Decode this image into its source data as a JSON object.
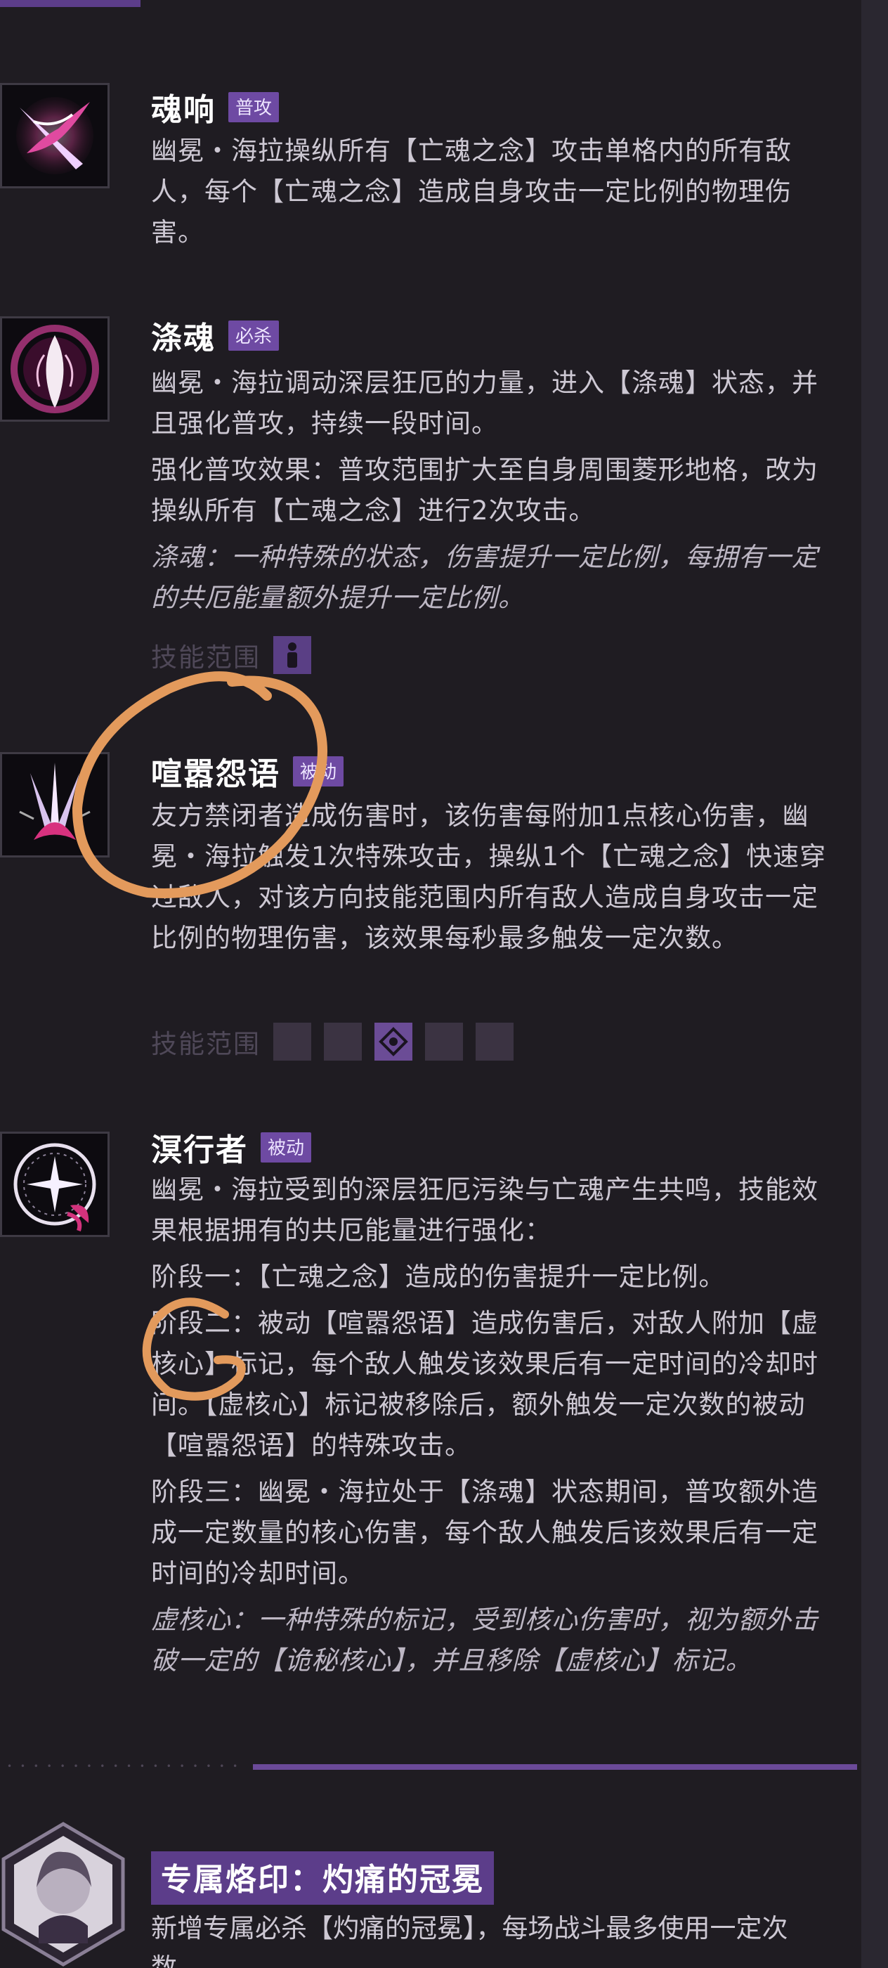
{
  "skills": [
    {
      "name": "魂响",
      "tag": "普攻",
      "icon": "soul-spear-icon",
      "paragraphs": [
        "幽冕・海拉操纵所有【亡魂之念】攻击单格内的所有敌人，每个【亡魂之念】造成自身攻击一定比例的物理伤害。"
      ]
    },
    {
      "name": "涤魂",
      "tag": "必杀",
      "icon": "soul-wisp-icon",
      "paragraphs": [
        "幽冕・海拉调动深层狂厄的力量，进入【涤魂】状态，并且强化普攻，持续一段时间。",
        "强化普攻效果：普攻范围扩大至自身周围菱形地格，改为操纵所有【亡魂之念】进行2次攻击。"
      ],
      "note": "涤魂：一种特殊的状态，伤害提升一定比例，每拥有一定的共厄能量额外提升一定比例。",
      "range_label": "技能范围"
    },
    {
      "name": "喧嚣怨语",
      "tag": "被动",
      "icon": "triple-spear-icon",
      "paragraphs": [
        "友方禁闭者造成伤害时，该伤害每附加1点核心伤害，幽冕・海拉触发1次特殊攻击，操纵1个【亡魂之念】快速穿过敌人，对该方向技能范围内所有敌人造成自身攻击一定比例的物理伤害，该效果每秒最多触发一定次数。"
      ],
      "range_label": "技能范围"
    },
    {
      "name": "溟行者",
      "tag": "被动",
      "icon": "compass-cross-icon",
      "paragraphs": [
        "幽冕・海拉受到的深层狂厄污染与亡魂产生共鸣，技能效果根据拥有的共厄能量进行强化：",
        "阶段一：【亡魂之念】造成的伤害提升一定比例。",
        "阶段二：被动【喧嚣怨语】造成伤害后，对敌人附加【虚核心】标记，每个敌人触发该效果后有一定时间的冷却时间。【虚核心】标记被移除后，额外触发一定次数的被动【喧嚣怨语】的特殊攻击。",
        "阶段三：幽冕・海拉处于【涤魂】状态期间，普攻额外造成一定数量的核心伤害，每个敌人触发后该效果后有一定时间的冷却时间。"
      ],
      "note": "虚核心：一种特殊的标记，受到核心伤害时，视为额外击破一定的【诡秘核心】，并且移除【虚核心】标记。"
    }
  ],
  "brand": {
    "title": "专属烙印：灼痛的冠冕",
    "desc": "新增专属必杀【灼痛的冠冕】，每场战斗最多使用一定次数。",
    "avatar_icon": "character-portrait-icon"
  },
  "colors": {
    "background": "#1f1c22",
    "accent_purple": "#6e4aa3",
    "annotation_orange": "#e39a5c"
  }
}
